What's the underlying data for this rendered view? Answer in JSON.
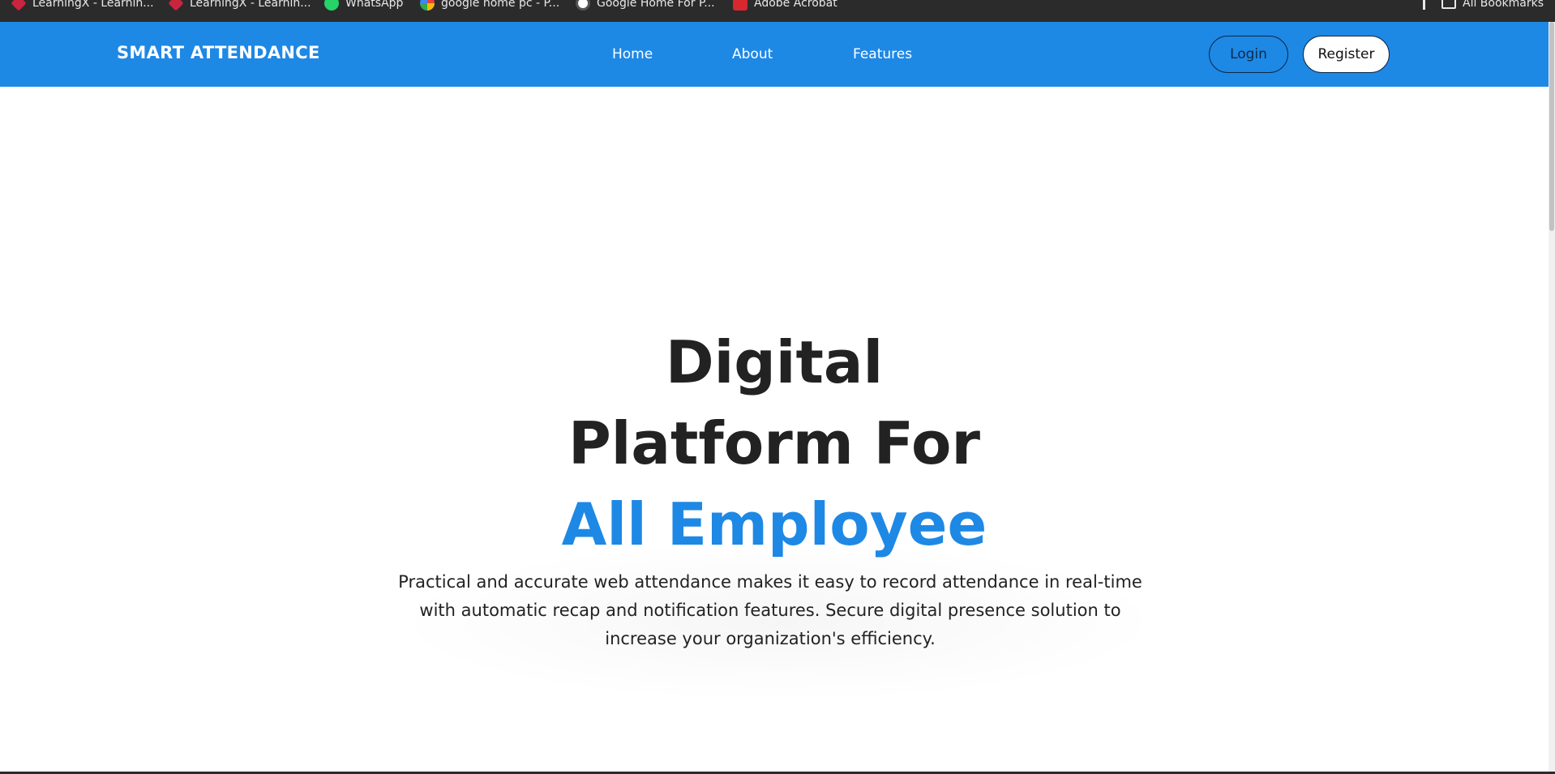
{
  "bookmarks": [
    {
      "label": "LearningX - Learnin...",
      "icon": "learningx-icon"
    },
    {
      "label": "LearningX - Learnin...",
      "icon": "learningx-icon"
    },
    {
      "label": "WhatsApp",
      "icon": "whatsapp-icon"
    },
    {
      "label": "google home pc - P...",
      "icon": "google-icon"
    },
    {
      "label": "Google Home For P...",
      "icon": "globe-icon"
    },
    {
      "label": "Adobe Acrobat",
      "icon": "acrobat-icon"
    }
  ],
  "all_bookmarks_label": "All Bookmarks",
  "navbar": {
    "brand": "SMART ATTENDANCE",
    "links": [
      "Home",
      "About",
      "Features"
    ],
    "login_label": "Login",
    "register_label": "Register"
  },
  "hero": {
    "title_line1": "Digital",
    "title_line2": "Platform For",
    "title_highlight": "All Employee",
    "description": "Practical and accurate web attendance makes it easy to record attendance in real-time with automatic recap and notification features. Secure digital presence solution to increase your organization's efficiency."
  },
  "colors": {
    "primary": "#1e88e5",
    "heading": "#222222",
    "bookmarks_bg": "#2b2b2b"
  }
}
